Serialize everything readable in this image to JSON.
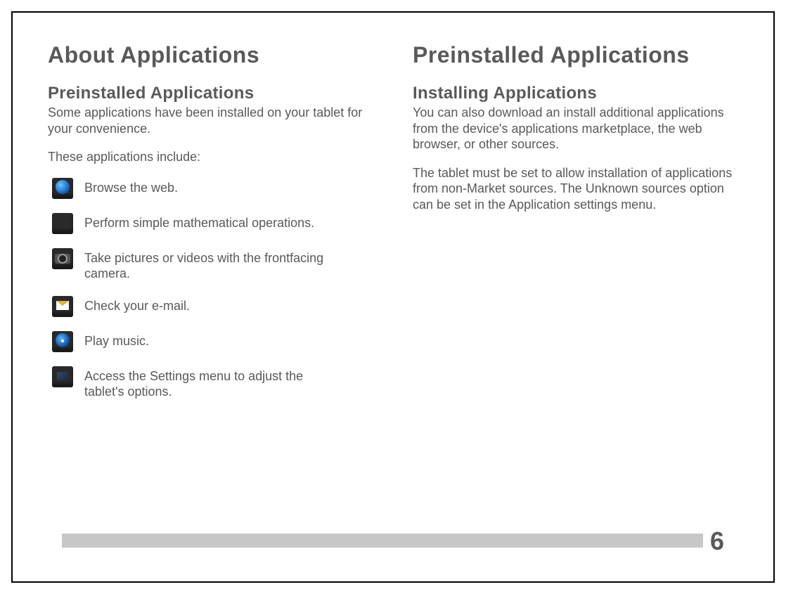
{
  "left": {
    "title": "About Applications",
    "subtitle": "Preinstalled Applications",
    "intro1": "Some applications have been installed on your tablet for your convenience.",
    "intro2": "These applications include:",
    "apps": [
      {
        "icon": "browser",
        "desc": "Browse the web."
      },
      {
        "icon": "calc",
        "desc": "Perform simple mathematical operations."
      },
      {
        "icon": "camera",
        "desc": "Take pictures or videos with the frontfacing camera."
      },
      {
        "icon": "email",
        "desc": "Check your e-mail."
      },
      {
        "icon": "music",
        "desc": "Play music."
      },
      {
        "icon": "settings",
        "desc": "Access the Settings menu to adjust the tablet's options."
      }
    ]
  },
  "right": {
    "title": "Preinstalled Applications",
    "subtitle": "Installing Applications",
    "p1": "You can also download an install additional applications from the device's applications marketplace, the web browser, or other sources.",
    "p2": "The tablet must be set to allow installation of applications from non-Market sources. The Unknown sources option can be set in the Application settings menu."
  },
  "page_number": "6"
}
